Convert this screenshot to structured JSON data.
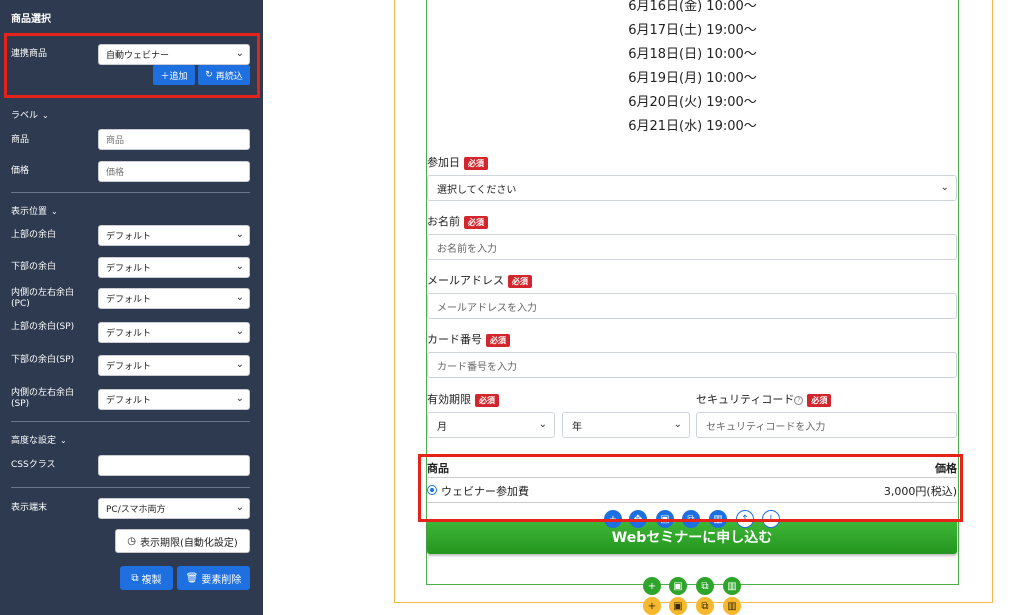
{
  "sidebar": {
    "title": "商品選択",
    "linked_product": {
      "label": "連携商品",
      "value": "自動ウェビナー",
      "add_label": "＋追加",
      "reload_label": "再読込"
    },
    "label_section": "ラベル",
    "product_label": {
      "label": "商品",
      "placeholder": "商品"
    },
    "price_label": {
      "label": "価格",
      "placeholder": "価格"
    },
    "position_section": "表示位置",
    "margins": [
      {
        "label": "上部の余白",
        "value": "デフォルト"
      },
      {
        "label": "下部の余白",
        "value": "デフォルト"
      },
      {
        "label": "内側の左右余白(PC)",
        "value": "デフォルト"
      },
      {
        "label": "上部の余白(SP)",
        "value": "デフォルト"
      },
      {
        "label": "下部の余白(SP)",
        "value": "デフォルト"
      },
      {
        "label": "内側の左右余白(SP)",
        "value": "デフォルト"
      }
    ],
    "advanced_section": "高度な設定",
    "css_class_label": "CSSクラス",
    "css_class_value": "",
    "device_label": "表示端末",
    "device_value": "PC/スマホ両方",
    "period_button": "表示期限(自動化設定)",
    "duplicate_button": "複製",
    "delete_button": "要素削除"
  },
  "form": {
    "dates": [
      "6月16日(金) 10:00〜",
      "6月17日(土) 19:00〜",
      "6月18日(日) 10:00〜",
      "6月19日(月) 10:00〜",
      "6月20日(火) 19:00〜",
      "6月21日(水) 19:00〜"
    ],
    "required": "必須",
    "date_label": "参加日",
    "date_placeholder": "選択してください",
    "name_label": "お名前",
    "name_placeholder": "お名前を入力",
    "email_label": "メールアドレス",
    "email_placeholder": "メールアドレスを入力",
    "card_label": "カード番号",
    "card_placeholder": "カード番号を入力",
    "expiry_label": "有効期限",
    "month_value": "月",
    "year_value": "年",
    "security_label": "セキュリティコード",
    "security_placeholder": "セキュリティコードを入力",
    "product_header": "商品",
    "price_header": "価格",
    "product_name": "ウェビナー参加費",
    "product_price": "3,000円(税込)",
    "submit_label": "Webセミナーに申し込む"
  },
  "colors": {
    "sidebar_bg": "#2d3a4f",
    "accent_blue": "#1e6fe0",
    "highlight_red": "#e5231b",
    "submit_green": "#2ea52a",
    "frame_green": "#4cad4c",
    "frame_orange": "#f2b84b",
    "tool_orange": "#f5b82e"
  },
  "icons": [
    "chevron-down-icon",
    "plus-icon",
    "reload-icon",
    "clock-icon",
    "copy-icon",
    "trash-icon",
    "save-icon",
    "move-icon",
    "arrow-up-icon",
    "arrow-down-icon",
    "question-icon"
  ]
}
